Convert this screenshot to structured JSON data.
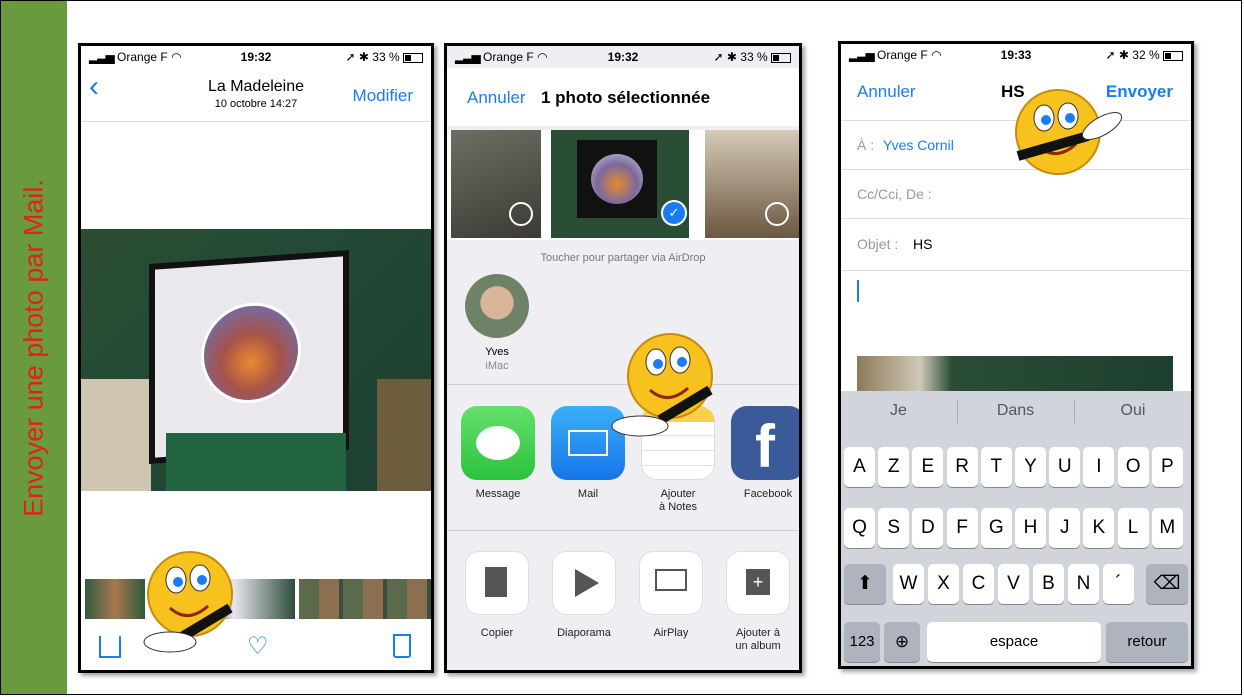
{
  "sidebar": {
    "text": "Envoyer une photo par Mail."
  },
  "status1": {
    "carrier": "Orange F",
    "time": "19:32",
    "right": "33 %"
  },
  "status2": {
    "carrier": "Orange F",
    "time": "19:32",
    "right": "33 %"
  },
  "status3": {
    "carrier": "Orange F",
    "time": "19:33",
    "right": "32 %"
  },
  "photos": {
    "title": "La Madeleine",
    "subtitle": "10 octobre 14:27",
    "edit": "Modifier"
  },
  "share": {
    "cancel": "Annuler",
    "title": "1 photo sélectionnée",
    "airdrop_hint": "Toucher pour partager via AirDrop",
    "contact_name": "Yves",
    "contact_device": "iMac",
    "apps": [
      {
        "label": "Message",
        "icon": "message-icon"
      },
      {
        "label": "Mail",
        "icon": "mail-icon"
      },
      {
        "label": "Ajouter\nà Notes",
        "icon": "notes-icon"
      },
      {
        "label": "Facebook",
        "icon": "facebook-icon"
      }
    ],
    "actions": [
      {
        "label": "Copier",
        "icon": "copy-icon"
      },
      {
        "label": "Diaporama",
        "icon": "play-icon"
      },
      {
        "label": "AirPlay",
        "icon": "airplay-icon"
      },
      {
        "label": "Ajouter à\nun album",
        "icon": "add-album-icon"
      }
    ]
  },
  "mail": {
    "cancel": "Annuler",
    "subject_title": "HS",
    "send": "Envoyer",
    "to_label": "À :",
    "to_value": "Yves Cornil",
    "cc_label": "Cc/Cci, De :",
    "subject_label": "Objet :",
    "subject_value": "HS"
  },
  "keyboard": {
    "suggestions": [
      "Je",
      "Dans",
      "Oui"
    ],
    "row1": [
      "A",
      "Z",
      "E",
      "R",
      "T",
      "Y",
      "U",
      "I",
      "O",
      "P"
    ],
    "row2": [
      "Q",
      "S",
      "D",
      "F",
      "G",
      "H",
      "J",
      "K",
      "L",
      "M"
    ],
    "row3": [
      "W",
      "X",
      "C",
      "V",
      "B",
      "N",
      "´"
    ],
    "numbers": "123",
    "space": "espace",
    "return": "retour"
  },
  "colors": {
    "accent": "#1a7cf5",
    "sidebar": "#6a9a3e",
    "sidebar_text": "#e0221b"
  }
}
